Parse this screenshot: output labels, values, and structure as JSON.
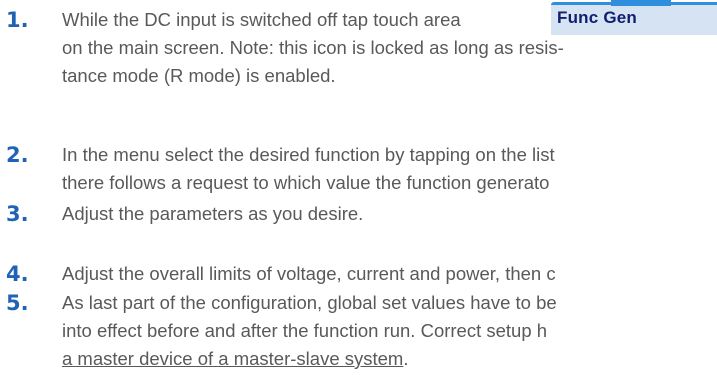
{
  "icon": {
    "name": "func-gen-icon",
    "label": "Func Gen"
  },
  "steps": [
    {
      "number": "1.",
      "lines": [
        "While the DC input is switched off tap touch area",
        "on the main screen. Note: this icon is locked as long as resis-",
        "tance mode (R mode) is enabled."
      ]
    },
    {
      "number": "2.",
      "lines": [
        "In the menu select the desired function by tapping on the list",
        "there follows a request to which value the function generato"
      ]
    },
    {
      "number": "3.",
      "lines": [
        "Adjust the parameters as you desire."
      ]
    },
    {
      "number": "4.",
      "lines": [
        "Adjust the overall limits of voltage, current and power, then c"
      ]
    },
    {
      "number": "5.",
      "lines": [
        "As last part of the configuration, global set values have to be",
        "into effect before and after the function run. Correct setup h"
      ],
      "link_text": "a master device of a master-slave system",
      "trailing": "."
    }
  ],
  "colors": {
    "number": "#1f64b4",
    "text": "#595959",
    "icon_bg": "#d6e3f3",
    "icon_accent": "#2f8fdc",
    "icon_label": "#0f1f6e"
  }
}
